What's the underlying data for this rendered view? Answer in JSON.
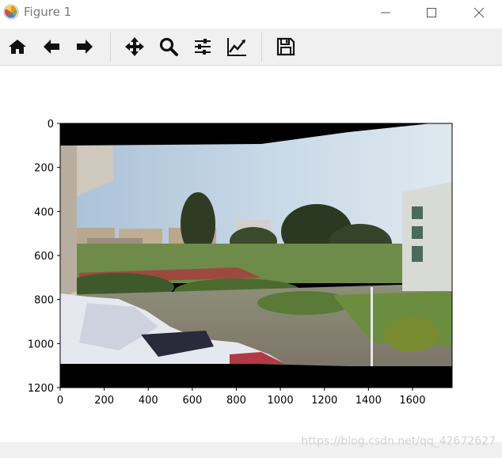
{
  "window": {
    "title": "Figure 1",
    "icons": {
      "app": "matplotlib-logo-icon",
      "minimize": "minimize-icon",
      "maximize": "maximize-icon",
      "close": "close-icon"
    }
  },
  "toolbar": {
    "buttons": [
      {
        "id": "home",
        "icon": "home-icon"
      },
      {
        "id": "back",
        "icon": "arrow-left-icon"
      },
      {
        "id": "forward",
        "icon": "arrow-right-icon"
      },
      {
        "id": "pan",
        "icon": "move-arrows-icon"
      },
      {
        "id": "zoom",
        "icon": "magnifier-icon"
      },
      {
        "id": "subplots",
        "icon": "sliders-icon"
      },
      {
        "id": "edit",
        "icon": "line-chart-icon"
      },
      {
        "id": "save",
        "icon": "floppy-disk-icon"
      }
    ]
  },
  "plot": {
    "image_content": "stitched panorama photo of a campus",
    "x_ticks": [
      "0",
      "200",
      "400",
      "600",
      "800",
      "1000",
      "1200",
      "1400",
      "1600"
    ],
    "y_ticks": [
      "0",
      "200",
      "400",
      "600",
      "800",
      "1000",
      "1200"
    ],
    "x_range": [
      0,
      1780
    ],
    "y_range": [
      1200,
      0
    ]
  },
  "watermark": "https://blog.csdn.net/qq_42672627"
}
